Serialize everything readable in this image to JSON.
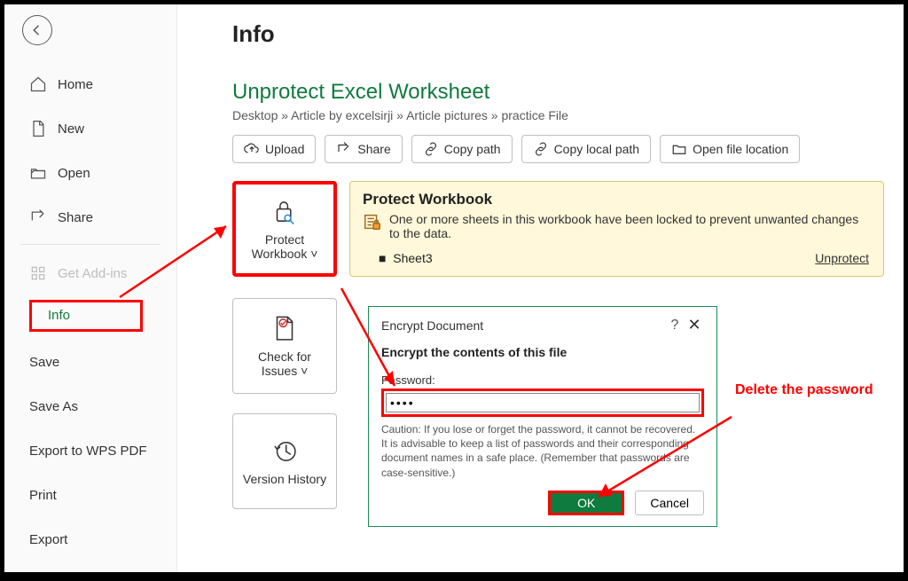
{
  "sidebar": {
    "items": {
      "home": "Home",
      "new": "New",
      "open": "Open",
      "share": "Share",
      "get_addins": "Get Add-ins",
      "info": "Info",
      "save": "Save",
      "save_as": "Save As",
      "export_wps": "Export to WPS PDF",
      "print": "Print",
      "export": "Export"
    }
  },
  "page": {
    "title": "Info",
    "doc_title": "Unprotect Excel Worksheet",
    "breadcrumb": "Desktop » Article by excelsirji » Article pictures » practice File"
  },
  "actions": {
    "upload": "Upload",
    "share": "Share",
    "copy_path": "Copy path",
    "copy_local": "Copy local path",
    "open_loc": "Open file location"
  },
  "tiles": {
    "protect": "Protect Workbook ˅",
    "issues": "Check for Issues ˅",
    "version": "Version History"
  },
  "protect_panel": {
    "heading": "Protect Workbook",
    "desc": "One or more sheets in this workbook have been locked to prevent unwanted changes to the data.",
    "sheet": "Sheet3",
    "unprotect_label": "Unprotect"
  },
  "dialog": {
    "title": "Encrypt Document",
    "subtitle": "Encrypt the contents of this file",
    "pw_label": "Password:",
    "pw_value": "••••",
    "caution": "Caution: If you lose or forget the password, it cannot be recovered. It is advisable to keep a list of passwords and their corresponding document names in a safe place. (Remember that passwords are case-sensitive.)",
    "ok": "OK",
    "cancel": "Cancel"
  },
  "annotation": {
    "delete_pw": "Delete the password"
  }
}
